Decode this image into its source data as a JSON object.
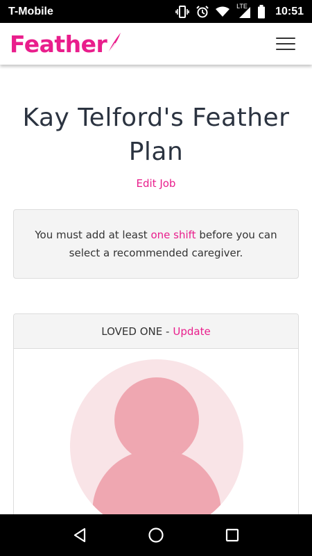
{
  "status_bar": {
    "carrier": "T-Mobile",
    "network": "LTE",
    "time": "10:51"
  },
  "header": {
    "logo_text": "Feather",
    "menu_icon": "hamburger-menu-icon"
  },
  "page": {
    "title": "Kay Telford's Feather Plan",
    "edit_link": "Edit Job"
  },
  "notice": {
    "text_before": "You must add at least ",
    "link_text": "one shift",
    "text_after": " before you can select a recommended caregiver."
  },
  "loved_one_card": {
    "header_label": "LOVED ONE -",
    "update_link": "Update"
  },
  "colors": {
    "brand": "#e91e8c",
    "avatar_bg": "#f9e4e7",
    "avatar_fg": "#efa7b1"
  },
  "nav": {
    "back_icon": "back-triangle-icon",
    "home_icon": "home-circle-icon",
    "recents_icon": "recents-square-icon"
  }
}
